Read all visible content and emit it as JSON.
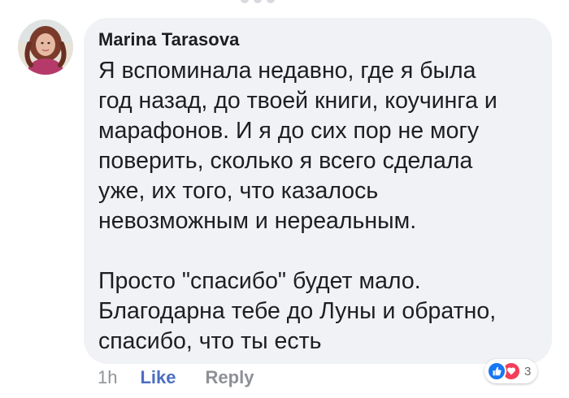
{
  "comment": {
    "author": "Marina Tarasova",
    "paragraphs": [
      [
        "Я вспоминала недавно, где я была",
        "год назад, до твоей книги, коучинга и",
        "марафонов. И я до сих пор не могу",
        "поверить, сколько я всего сделала",
        "уже, их того, что казалось",
        "невозможным и нереальным."
      ],
      [
        "Просто \"спасибо\" будет мало.",
        "Благодарна тебе до Луны и обратно,",
        "спасибо, что ты есть"
      ]
    ]
  },
  "actions": {
    "time": "1h",
    "like_label": "Like",
    "reply_label": "Reply"
  },
  "reactions": {
    "icons": [
      "like-icon",
      "love-icon"
    ],
    "count": "3"
  },
  "colors": {
    "bubble": "#f0f2f5",
    "like_link": "#4b6ec4",
    "like_reaction": "#1877f2",
    "love_reaction": "#f33e58"
  }
}
